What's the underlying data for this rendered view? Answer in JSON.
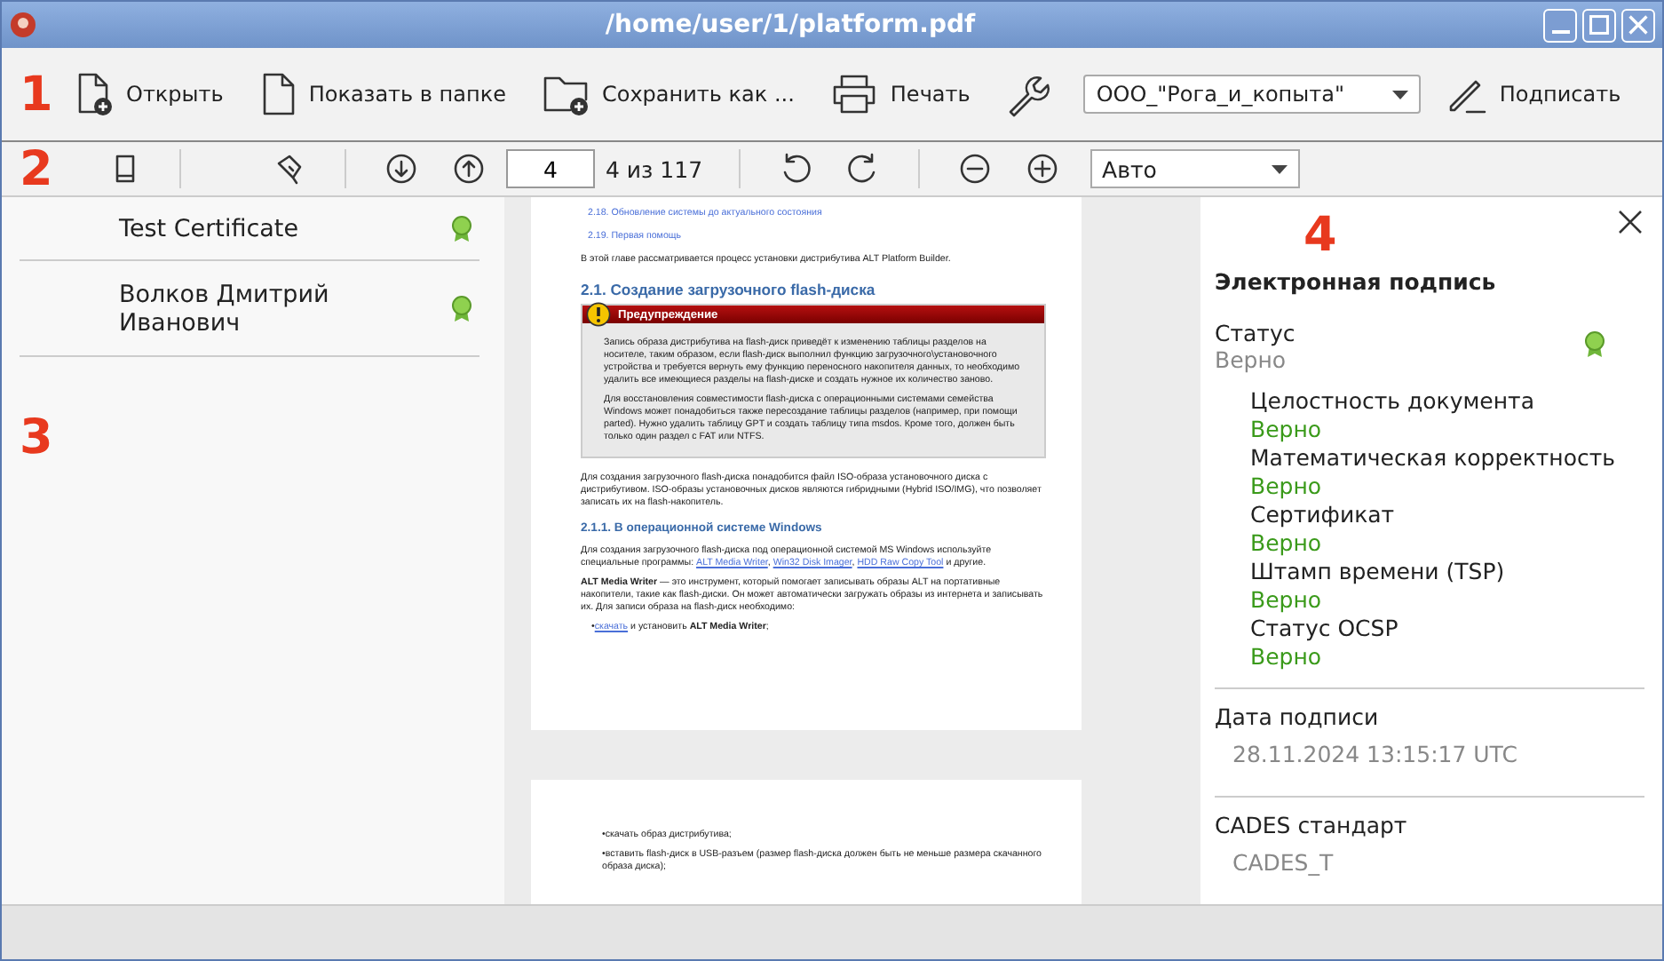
{
  "window": {
    "title": "/home/user/1/platform.pdf"
  },
  "main_toolbar": {
    "marker": "1",
    "buttons": [
      {
        "kind": "open",
        "label": "Открыть"
      },
      {
        "kind": "folder",
        "label": "Показать в папке"
      },
      {
        "kind": "save",
        "label": "Сохранить как ..."
      },
      {
        "kind": "print",
        "label": "Печать"
      },
      {
        "kind": "settings"
      }
    ],
    "organization": "ООО_\"Рога_и_копыта\"",
    "sign_button": "Подписать"
  },
  "nav_toolbar": {
    "marker": "2",
    "page": "4",
    "page_count": "4 из 117",
    "zoom": "Авто"
  },
  "certificates": {
    "marker": "3",
    "items": [
      {
        "name": "Test Certificate",
        "verified": true
      },
      {
        "name": "Волков Дмитрий Иванович",
        "verified": true
      }
    ]
  },
  "document": {
    "pages": [
      {
        "blocks": [
          {
            "kind": "toc",
            "parts": [
              {
                "kind": "link",
                "text": "2.18. Обновление системы до актуального состояния"
              }
            ]
          },
          {
            "kind": "toc",
            "parts": [
              {
                "kind": "link",
                "text": "2.19. Первая помощь"
              }
            ]
          },
          {
            "kind": "para",
            "parts": [
              {
                "kind": "text",
                "text": "В этой главе рассматривается процесс установки дистрибутива ALT Platform Builder."
              }
            ]
          },
          {
            "kind": "h2",
            "parts": [
              {
                "kind": "text",
                "text": "2.1. Создание загрузочного flash-диска"
              }
            ]
          },
          {
            "kind": "warning",
            "title": "Предупреждение",
            "paragraphs": [
              "Запись образа дистрибутива на flash-диск приведёт к изменению таблицы разделов на носителе, таким образом, если flash-диск выполнил функцию загрузочного\\установочного устройства и требуется вернуть ему функцию переносного накопителя данных, то необходимо удалить все имеющиеся разделы на flash-диске и создать нужное их количество заново.",
              "Для восстановления совместимости flash-диска с операционными системами семейства Windows может понадобиться также пересоздание таблицы разделов (например, при помощи parted). Нужно удалить таблицу GPT и создать таблицу типа msdos. Кроме того, должен быть только один раздел с FAT или NTFS."
            ]
          },
          {
            "kind": "para",
            "parts": [
              {
                "kind": "text",
                "text": "Для создания загрузочного flash-диска понадобится файл ISO-образа установочного диска с дистрибутивом. ISO-образы установочных дисков являются гибридными (Hybrid ISO/IMG), что позволяет записать их на flash-накопитель."
              }
            ]
          },
          {
            "kind": "h3",
            "parts": [
              {
                "kind": "text",
                "text": "2.1.1. В операционной системе Windows"
              }
            ]
          },
          {
            "kind": "para",
            "parts": [
              {
                "kind": "text",
                "text": "Для создания загрузочного flash-диска под операционной системой MS Windows используйте специальные программы: "
              },
              {
                "kind": "link",
                "text": "ALT Media Writer"
              },
              {
                "kind": "text",
                "text": ", "
              },
              {
                "kind": "link",
                "text": "Win32 Disk Imager"
              },
              {
                "kind": "text",
                "text": ", "
              },
              {
                "kind": "link",
                "text": "HDD Raw Copy Tool"
              },
              {
                "kind": "text",
                "text": " и другие."
              }
            ]
          },
          {
            "kind": "para",
            "parts": [
              {
                "kind": "bold",
                "text": "ALT Media Writer"
              },
              {
                "kind": "text",
                "text": " — это инструмент, который помогает записывать образы ALT на портативные накопители, такие как flash-диски. Он может автоматически загружать образы из интернета и записывать их. Для записи образа на flash-диск необходимо:"
              }
            ]
          },
          {
            "kind": "item",
            "parts": [
              {
                "kind": "text",
                "text": "•"
              },
              {
                "kind": "link",
                "text": "скачать"
              },
              {
                "kind": "text",
                "text": " и установить "
              },
              {
                "kind": "bold",
                "text": "ALT Media Writer"
              },
              {
                "kind": "text",
                "text": ";"
              }
            ]
          }
        ]
      },
      {
        "blocks": [
          {
            "kind": "item",
            "parts": [
              {
                "kind": "text",
                "text": "•скачать образ дистрибутива;"
              }
            ]
          },
          {
            "kind": "item",
            "parts": [
              {
                "kind": "text",
                "text": "•вставить flash-диск в USB-разъем (размер flash-диска должен быть не меньше размера скачанного образа диска);"
              }
            ]
          }
        ]
      }
    ]
  },
  "signature_panel": {
    "marker": "4",
    "title": "Электронная подпись",
    "status_label": "Статус",
    "status_value": "Верно",
    "verified": true,
    "checks": [
      {
        "label": "Целостность документа",
        "value": "Верно",
        "ok": true
      },
      {
        "label": "Математическая корректность",
        "value": "Верно",
        "ok": true
      },
      {
        "label": "Сертификат",
        "value": "Верно",
        "ok": true
      },
      {
        "label": "Штамп времени (TSP)",
        "value": "Верно",
        "ok": true
      },
      {
        "label": "Статус OCSP",
        "value": "Верно",
        "ok": true
      }
    ],
    "date_label": "Дата подписи",
    "date_value": "28.11.2024 13:15:17 UTC",
    "standard_label": "CADES стандарт",
    "standard_value": "CADES_T"
  }
}
